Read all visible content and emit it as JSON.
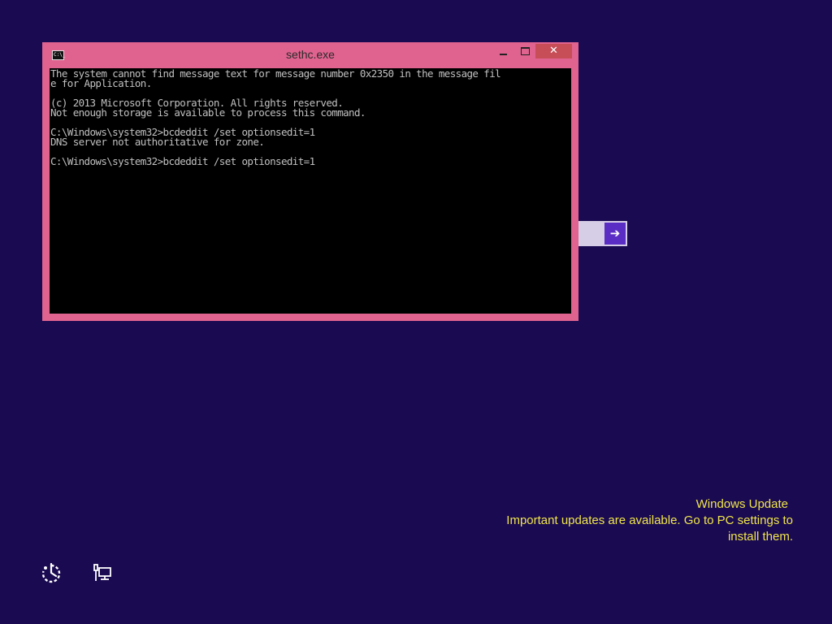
{
  "window": {
    "title": "sethc.exe",
    "icon_label": "C:\\_",
    "close_label": "✕"
  },
  "console": {
    "lines": [
      "The system cannot find message text for message number 0x2350 in the message fil",
      "e for Application.",
      "",
      "(c) 2013 Microsoft Corporation. All rights reserved.",
      "Not enough storage is available to process this command.",
      "",
      "C:\\Windows\\system32>bcdeddit /set optionsedit=1",
      "DNS server not authoritative for zone.",
      "",
      "C:\\Windows\\system32>bcdeddit /set optionsedit=1"
    ]
  },
  "side_button": {
    "icon": "arrow-right-icon",
    "glyph": "➔"
  },
  "notification": {
    "title": "Windows Update",
    "body_line1": "Important updates are available. Go to PC settings to",
    "body_line2": "install them."
  },
  "bottom_icons": [
    {
      "name": "ease-of-access-icon"
    },
    {
      "name": "network-icon"
    }
  ],
  "colors": {
    "background": "#1a0a52",
    "window_frame": "#e0638f",
    "close_button": "#c74d57",
    "console_bg": "#000000",
    "console_text": "#c0c0c0",
    "notification_text": "#f0e64a",
    "arrow_button": "#5a2dc4"
  }
}
